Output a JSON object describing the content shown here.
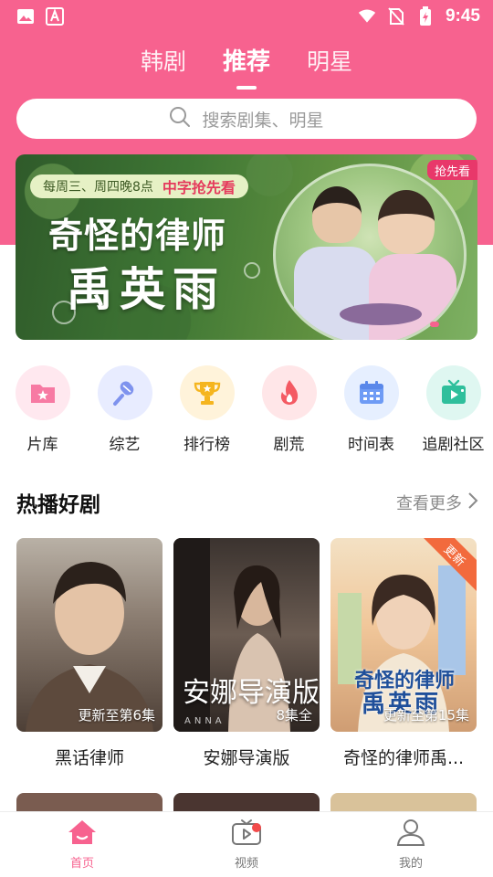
{
  "status_bar": {
    "time": "9:45"
  },
  "top_tabs": [
    {
      "label": "韩剧"
    },
    {
      "label": "推荐",
      "active": true
    },
    {
      "label": "明星"
    }
  ],
  "search": {
    "placeholder": "搜索剧集、明星"
  },
  "banner": {
    "schedule": "每周三、周四晚8点",
    "tag": "中字抢先看",
    "title_line1": "奇怪的律师",
    "title_line2": "禹英雨",
    "badge": "抢先看"
  },
  "categories": [
    {
      "label": "片库",
      "icon": "film-library-icon",
      "color": "#ffe8ef"
    },
    {
      "label": "综艺",
      "icon": "microphone-icon",
      "color": "#e8ecff"
    },
    {
      "label": "排行榜",
      "icon": "trophy-icon",
      "color": "#fff3da"
    },
    {
      "label": "剧荒",
      "icon": "flame-icon",
      "color": "#ffe6e8"
    },
    {
      "label": "时间表",
      "icon": "calendar-icon",
      "color": "#e6efff"
    },
    {
      "label": "追剧社区",
      "icon": "tv-icon",
      "color": "#dff7f1"
    }
  ],
  "section": {
    "title": "热播好剧",
    "more": "查看更多"
  },
  "dramas": [
    {
      "title": "黑话律师",
      "status": "更新至第6集"
    },
    {
      "title": "安娜导演版",
      "status": "8集全",
      "poster_text": "安娜导演版",
      "poster_small": "ANNA"
    },
    {
      "title": "奇怪的律师禹...",
      "status": "更新至第15集",
      "corner_tag": "更新",
      "poster_text1": "奇怪的律师",
      "poster_text2": "禹英雨"
    }
  ],
  "bottom_nav": [
    {
      "label": "首页",
      "icon": "home-icon",
      "active": true
    },
    {
      "label": "视频",
      "icon": "video-icon",
      "badge": true
    },
    {
      "label": "我的",
      "icon": "profile-icon"
    }
  ],
  "colors": {
    "brand": "#f7628f"
  }
}
